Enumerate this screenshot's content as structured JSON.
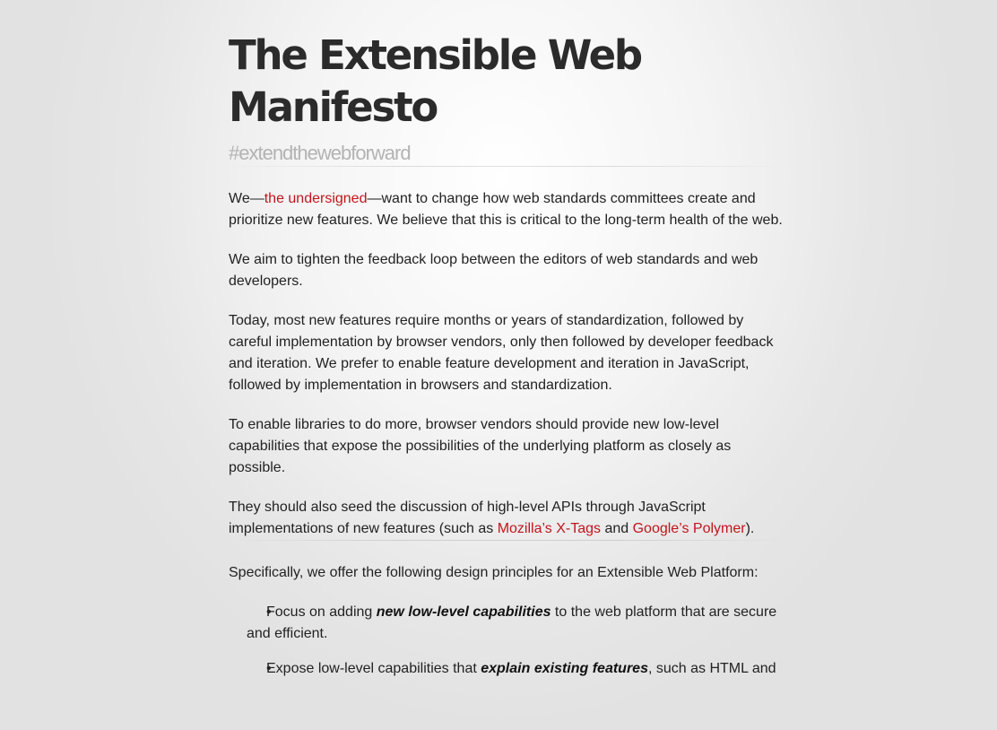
{
  "header": {
    "title": "The Extensible Web Manifesto",
    "tagline": "#extendthewebforward"
  },
  "intro": {
    "p1_before": "We—",
    "p1_link": "the undersigned",
    "p1_after": "—want to change how web standards committees create and prioritize new features. We believe that this is critical to the long-term health of the web.",
    "p2": "We aim to tighten the feedback loop between the editors of web standards and web developers.",
    "p3": "Today, most new features require months or years of standardization, followed by careful implementation by browser vendors, only then followed by developer feedback and iteration. We prefer to enable feature development and iteration in JavaScript, followed by implementation in browsers and standardization.",
    "p4": "To enable libraries to do more, browser vendors should provide new low-level capabilities that expose the possibilities of the underlying platform as closely as possible.",
    "p5_before": "They should also seed the discussion of high-level APIs through JavaScript implementations of new features (such as ",
    "p5_link1": "Mozilla’s X-Tags",
    "p5_mid": " and ",
    "p5_link2": "Google’s Polymer",
    "p5_after": ")."
  },
  "principles": {
    "lead": "Specifically, we offer the following design principles for an Extensible Web Platform:",
    "items": [
      {
        "before": "Focus on adding ",
        "emph": "new low-level capabilities",
        "after": " to the web platform that are secure and efficient."
      },
      {
        "before": "Expose low-level capabilities that ",
        "emph": "explain existing features",
        "after": ", such as HTML and"
      }
    ],
    "bullet": "•"
  },
  "colors": {
    "link": "#c0161d",
    "title": "#2b2b2b",
    "tagline": "#b3b3b3"
  }
}
